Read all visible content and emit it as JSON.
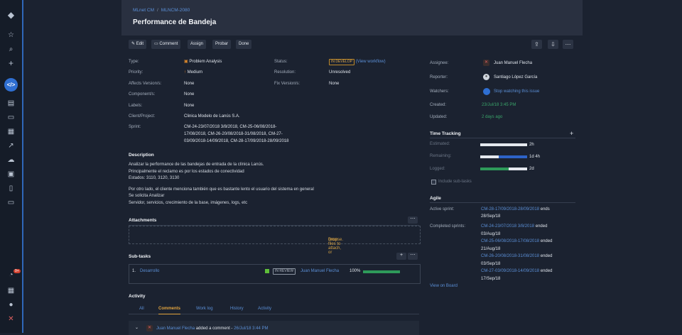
{
  "sidebar": {
    "icons": [
      "app-logo",
      "star",
      "search",
      "plus",
      "code",
      "layers",
      "document",
      "board",
      "chart",
      "cloud",
      "monitor",
      "notebook",
      "window",
      "notification",
      "grid",
      "help",
      "avatar"
    ],
    "active_label": "</>",
    "notification_count": "9+"
  },
  "breadcrumb": {
    "project": "MLnet CM",
    "issue_key": "MLNCM-2080"
  },
  "issue": {
    "title": "Performance de Bandeja"
  },
  "toolbar": {
    "edit": "Edit",
    "comment": "Comment",
    "assign": "Assign",
    "probar": "Probar",
    "done": "Done"
  },
  "details": {
    "type_label": "Type:",
    "type_value": "Problem Analysis",
    "priority_label": "Priority:",
    "priority_value": "Medium",
    "affects_label": "Affects Version/s:",
    "affects_value": "None",
    "components_label": "Component/s:",
    "components_value": "None",
    "labels_label": "Labels:",
    "labels_value": "None",
    "client_label": "Client/Project:",
    "client_value": "Clinica Modelo de Lanús S.A.",
    "sprint_label": "Sprint:",
    "sprint_lines": [
      "CM-24-23/07/2018 3/8/2018, CM-25-06/08/2018-",
      "17/08/2018, CM-26-20/08/2018-31/08/2018, CM-27-",
      "03/09/2018-14/09/2018, CM-28-17/09/2018-28/09/2018"
    ],
    "status_label": "Status:",
    "status_value": "IN DEVELOP",
    "view_workflow": "(View workflow)",
    "resolution_label": "Resolution:",
    "resolution_value": "Unresolved",
    "fix_label": "Fix Version/s:",
    "fix_value": "None"
  },
  "description": {
    "heading": "Description",
    "lines": [
      "Analizar la performance de las bandejas de entrada de la clínica Lanús.",
      "Principalmente el reclamo es por los estados de conectividad",
      "Estados: 3110, 3120, 3130",
      "Por otro lado, el cliente menciona también que es bastante lento el usuario del sistema en general",
      "Se solicita Analizar",
      "Servidor, servicios, crecimiento de la base, imágenes, logs, etc"
    ]
  },
  "attachments": {
    "heading": "Attachments",
    "drop_text": "Drop files to attach, or",
    "browse": "browse."
  },
  "subtasks": {
    "heading": "Sub-tasks",
    "items": [
      {
        "num": "1.",
        "name": "Desarrollo",
        "status": "IN REVIEW",
        "assignee": "Juan Manuel Flecha",
        "progress": "100%",
        "progress_fraction": 1.0
      }
    ]
  },
  "activity": {
    "heading": "Activity",
    "tabs": [
      "All",
      "Comments",
      "Work log",
      "History",
      "Activity"
    ],
    "active_tab": "Comments",
    "comment_author": "Juan Manuel Flecha",
    "comment_action": "added a comment -",
    "comment_time": "26/Jul/18 3:44 PM"
  },
  "people": {
    "assignee_label": "Assignee:",
    "assignee": "Juan Manuel Flecha",
    "reporter_label": "Reporter:",
    "reporter": "Santiago López García",
    "watchers_label": "Watchers:",
    "watch_link": "Stop watching this issue",
    "created_label": "Created:",
    "created": "23/Jul/18 3:45 PM",
    "updated_label": "Updated:",
    "updated": "2 days ago"
  },
  "time_tracking": {
    "heading": "Time Tracking",
    "estimated_label": "Estimated:",
    "estimated": "2h",
    "estimated_fraction": 1.0,
    "remaining_label": "Remaining:",
    "remaining": "1d 4h",
    "remaining_fraction": 0.4,
    "logged_label": "Logged:",
    "logged": "2d",
    "logged_fraction": 0.6,
    "include_subtasks": "Include sub-tasks"
  },
  "agile": {
    "heading": "Agile",
    "active_label": "Active sprint:",
    "active_sprint": "CM-28-17/09/2018-28/09/2018",
    "active_ends": "ends",
    "active_date": "28/Sep/18",
    "completed_label": "Completed sprints:",
    "completed": [
      {
        "name": "CM-24-23/07/2018 3/8/2018",
        "ended": "ended",
        "date": "03/Aug/18"
      },
      {
        "name": "CM-25-06/08/2018-17/08/2018",
        "ended": "ended",
        "date": "21/Aug/18"
      },
      {
        "name": "CM-26-20/08/2018-31/08/2018",
        "ended": "ended",
        "date": "03/Sep/18"
      },
      {
        "name": "CM-27-03/09/2018-14/09/2018",
        "ended": "ended",
        "date": "17/Sep/18"
      }
    ],
    "view_board": "View on Board"
  },
  "colors": {
    "accent": "#2f6fd2",
    "link": "#5b8fd6",
    "warning": "#d9a54b",
    "success": "#3aa46a"
  }
}
